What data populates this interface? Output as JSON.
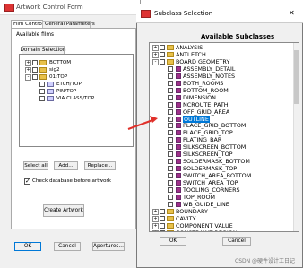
{
  "bg_window": {
    "title": "Artwork Control Form",
    "tabs": [
      "Film Control",
      "General Parameters"
    ],
    "available_films_label": "Available films",
    "domain_button": "Domain Selection",
    "tree": [
      {
        "label": "BOTTOM",
        "expander": "+"
      },
      {
        "label": "sig2",
        "expander": "+"
      },
      {
        "label": "01:TOP",
        "expander": "-"
      },
      {
        "label": "ETCH/TOP",
        "expander": ""
      },
      {
        "label": "PIN/TOP",
        "expander": ""
      },
      {
        "label": "VIA CLASS/TOP",
        "expander": ""
      }
    ],
    "select_all": "Select all",
    "add": "Add...",
    "replace": "Replace...",
    "check_db_label": "Check database before artwork",
    "create_artwork": "Create Artwork",
    "ok": "OK",
    "cancel": "Cancel",
    "apertures": "Apertures..."
  },
  "dialog": {
    "title": "Subclass Selection",
    "close_glyph": "✕",
    "heading": "Available Subclasses",
    "groups_top": [
      {
        "label": "ANALYSIS",
        "expander": "+"
      },
      {
        "label": "ANTI ETCH",
        "expander": "+"
      },
      {
        "label": "BOARD GEOMETRY",
        "expander": "-"
      }
    ],
    "subclasses": [
      {
        "label": "ASSEMBLY_DETAIL",
        "checked": false,
        "selected": false
      },
      {
        "label": "ASSEMBLY_NOTES",
        "checked": false,
        "selected": false
      },
      {
        "label": "BOTH_ROOMS",
        "checked": false,
        "selected": false
      },
      {
        "label": "BOTTOM_ROOM",
        "checked": false,
        "selected": false
      },
      {
        "label": "DIMENSION",
        "checked": false,
        "selected": false
      },
      {
        "label": "NCROUTE_PATH",
        "checked": false,
        "selected": false
      },
      {
        "label": "OFF_GRID_AREA",
        "checked": false,
        "selected": false
      },
      {
        "label": "OUTLINE",
        "checked": true,
        "selected": true
      },
      {
        "label": "PLACE_GRID_BOTTOM",
        "checked": false,
        "selected": false
      },
      {
        "label": "PLACE_GRID_TOP",
        "checked": false,
        "selected": false
      },
      {
        "label": "PLATING_BAR",
        "checked": false,
        "selected": false
      },
      {
        "label": "SILKSCREEN_BOTTOM",
        "checked": false,
        "selected": false
      },
      {
        "label": "SILKSCREEN_TOP",
        "checked": false,
        "selected": false
      },
      {
        "label": "SOLDERMASK_BOTTOM",
        "checked": false,
        "selected": false
      },
      {
        "label": "SOLDERMASK_TOP",
        "checked": false,
        "selected": false
      },
      {
        "label": "SWITCH_AREA_BOTTOM",
        "checked": false,
        "selected": false
      },
      {
        "label": "SWITCH_AREA_TOP",
        "checked": false,
        "selected": false
      },
      {
        "label": "TOOLING_CORNERS",
        "checked": false,
        "selected": false
      },
      {
        "label": "TOP_ROOM",
        "checked": false,
        "selected": false
      },
      {
        "label": "WB_GUIDE_LINE",
        "checked": false,
        "selected": false
      }
    ],
    "groups_bottom": [
      {
        "label": "BOUNDARY",
        "expander": "+"
      },
      {
        "label": "CAVITY",
        "expander": "+"
      },
      {
        "label": "COMPONENT VALUE",
        "expander": "+"
      },
      {
        "label": "CONSTRAINT REGION",
        "expander": "+"
      },
      {
        "label": "DEVICE TYPE",
        "expander": "+"
      }
    ],
    "ok": "OK",
    "cancel": "Cancel"
  },
  "colors": {
    "selection": "#0078d7",
    "swatch": "#a0308a",
    "arrow": "#e0302a",
    "folder": "#e8c14a"
  },
  "watermark": "CSDN @硬件设计工日记"
}
